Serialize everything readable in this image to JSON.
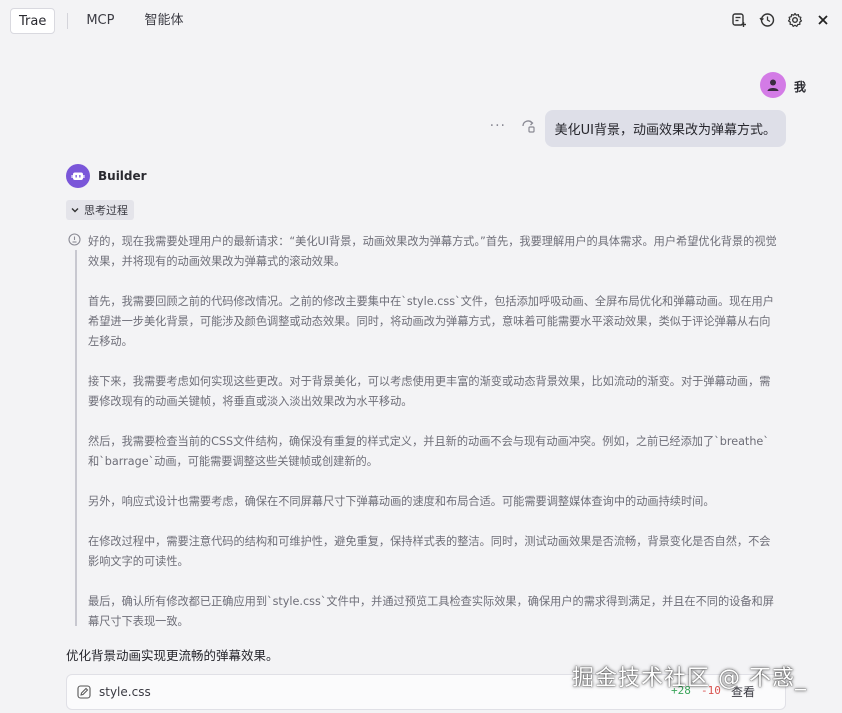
{
  "header": {
    "tabs": [
      {
        "label": "Trae"
      },
      {
        "label": "MCP"
      },
      {
        "label": "智能体"
      }
    ],
    "icons": [
      "new-chat-icon",
      "history-icon",
      "gear-icon",
      "close-icon"
    ]
  },
  "user": {
    "name": "我",
    "message": "美化UI背景，动画效果改为弹幕方式。"
  },
  "builder": {
    "name": "Builder",
    "think_label": "思考过程",
    "paragraphs": [
      "好的，现在我需要处理用户的最新请求：“美化UI背景，动画效果改为弹幕方式。”首先，我要理解用户的具体需求。用户希望优化背景的视觉效果，并将现有的动画效果改为弹幕式的滚动效果。",
      "首先，我需要回顾之前的代码修改情况。之前的修改主要集中在`style.css`文件，包括添加呼吸动画、全屏布局优化和弹幕动画。现在用户希望进一步美化背景，可能涉及颜色调整或动态效果。同时，将动画改为弹幕方式，意味着可能需要水平滚动效果，类似于评论弹幕从右向左移动。",
      "接下来，我需要考虑如何实现这些更改。对于背景美化，可以考虑使用更丰富的渐变或动态背景效果，比如流动的渐变。对于弹幕动画，需要修改现有的动画关键帧，将垂直或淡入淡出效果改为水平移动。",
      "然后，我需要检查当前的CSS文件结构，确保没有重复的样式定义，并且新的动画不会与现有动画冲突。例如，之前已经添加了`breathe`和`barrage`动画，可能需要调整这些关键帧或创建新的。",
      "另外，响应式设计也需要考虑，确保在不同屏幕尺寸下弹幕动画的速度和布局合适。可能需要调整媒体查询中的动画持续时间。",
      "在修改过程中，需要注意代码的结构和可维护性，避免重复，保持样式表的整洁。同时，测试动画效果是否流畅，背景变化是否自然，不会影响文字的可读性。",
      "最后，确认所有修改都已正确应用到`style.css`文件中，并通过预览工具检查实际效果，确保用户的需求得到满足，并且在不同的设备和屏幕尺寸下表现一致。"
    ],
    "answer": "优化背景动画实现更流畅的弹幕效果。",
    "file": {
      "name": "style.css",
      "added": "+28",
      "removed": "-10",
      "action": "查看"
    }
  },
  "watermark": "掘金技术社区 @ 不惑_",
  "colors": {
    "user_avatar": "#d37be6",
    "bot_avatar": "#7a56d9",
    "bubble": "#dedfe8",
    "background": "#f3f3f5"
  }
}
